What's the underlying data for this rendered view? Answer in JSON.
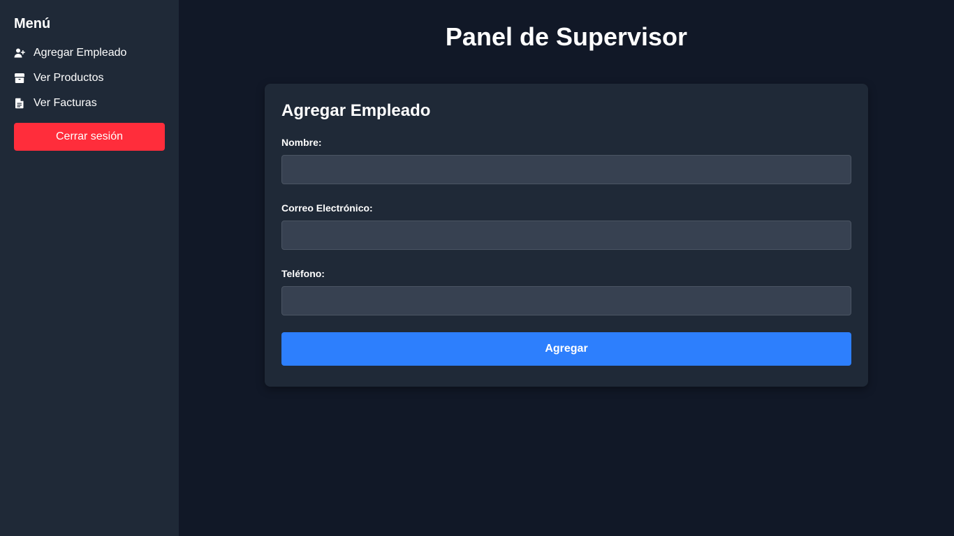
{
  "sidebar": {
    "title": "Menú",
    "items": [
      {
        "label": "Agregar Empleado",
        "icon": "user-plus-icon"
      },
      {
        "label": "Ver Productos",
        "icon": "box-icon"
      },
      {
        "label": "Ver Facturas",
        "icon": "document-icon"
      }
    ],
    "logout_label": "Cerrar sesión"
  },
  "main": {
    "title": "Panel de Supervisor",
    "form": {
      "title": "Agregar Empleado",
      "fields": [
        {
          "label": "Nombre:",
          "value": "",
          "placeholder": ""
        },
        {
          "label": "Correo Electrónico:",
          "value": "",
          "placeholder": ""
        },
        {
          "label": "Teléfono:",
          "value": "",
          "placeholder": ""
        }
      ],
      "submit_label": "Agregar"
    }
  },
  "colors": {
    "page_background": "#111827",
    "sidebar_background": "#1f2937",
    "card_background": "#1f2937",
    "input_background": "#374151",
    "logout_button": "#ff2d3b",
    "submit_button": "#2d7ffd",
    "text": "#ffffff"
  }
}
